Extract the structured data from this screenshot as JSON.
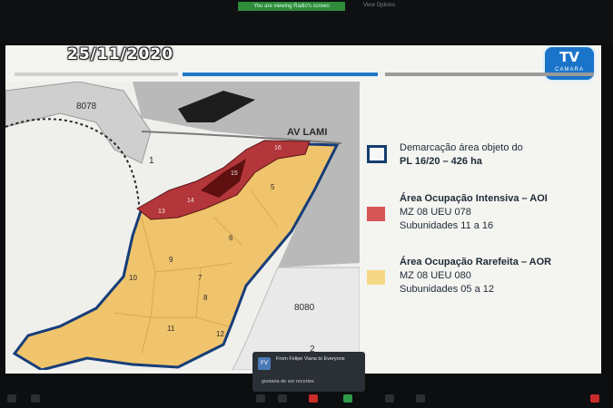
{
  "meeting": {
    "sharing_banner": "You are viewing Radio's screen",
    "top_right": "View Options"
  },
  "slide": {
    "date": "25/11/2020",
    "logo": {
      "main": "TV",
      "sub": "CAMARA"
    },
    "colors": {
      "aoi": "#d65656",
      "aor": "#f5d785",
      "outline": "#153e6e",
      "header_blue": "#1e79c8"
    },
    "map": {
      "street": "AV LAMI",
      "codes": [
        "8078",
        "8080"
      ],
      "parcel_numbers": [
        "1",
        "2",
        "5",
        "6",
        "7",
        "8",
        "9",
        "10",
        "11",
        "12",
        "13",
        "14",
        "15",
        "16"
      ]
    },
    "legend": {
      "demarcation_line1": "Demarcação área objeto do",
      "demarcation_line2": "PL 16/20 – 426 ha",
      "aoi_title": "Área Ocupação Intensiva – AOI",
      "aoi_mz": "MZ 08 UEU 078",
      "aoi_sub": "Subunidades 11 a 16",
      "aor_title": "Área Ocupação Rarefeita – AOR",
      "aor_mz": "MZ 08 UEU 080",
      "aor_sub": "Subunidades 05 a 12"
    }
  },
  "chat": {
    "avatar": "FV",
    "from": "From Felipe Viana to Everyone",
    "message": "gostaria de ser recortes"
  }
}
